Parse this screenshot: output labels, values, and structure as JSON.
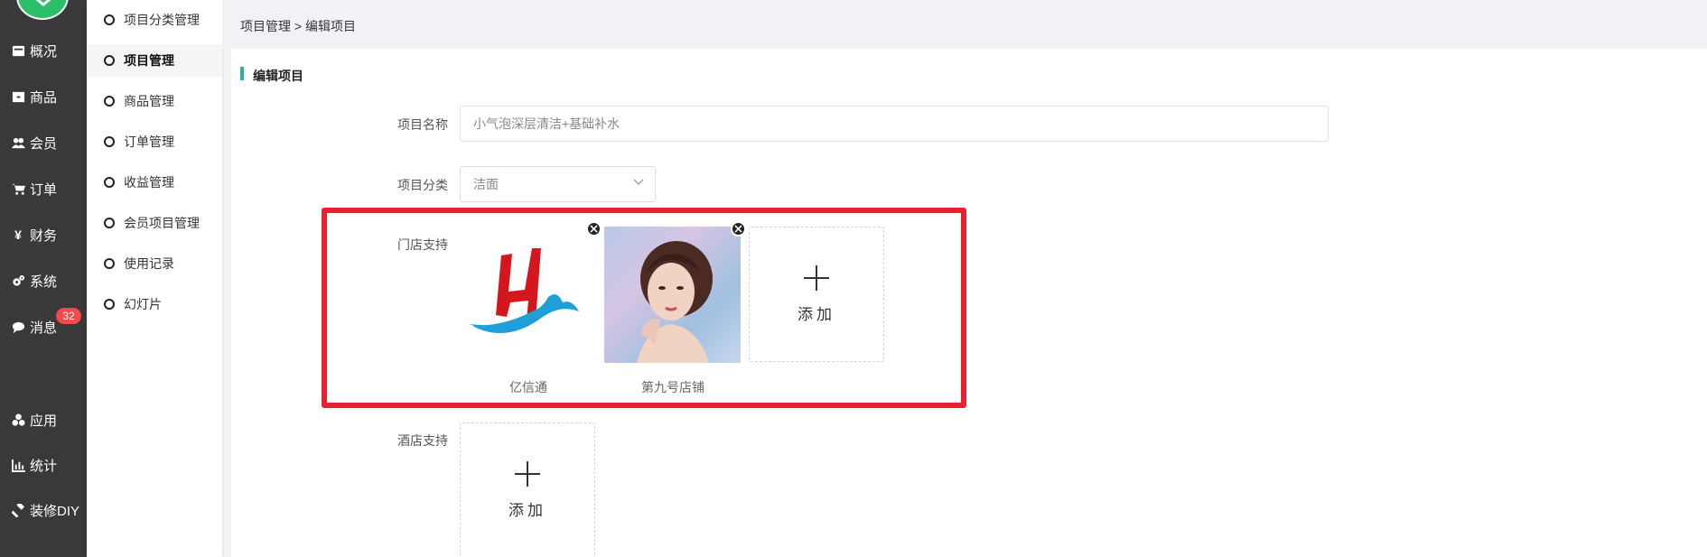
{
  "sidebar": {
    "items": [
      {
        "label": "概况",
        "icon": "overview-icon"
      },
      {
        "label": "商品",
        "icon": "goods-icon"
      },
      {
        "label": "会员",
        "icon": "members-icon"
      },
      {
        "label": "订单",
        "icon": "cart-icon"
      },
      {
        "label": "财务",
        "icon": "yen-icon"
      },
      {
        "label": "系统",
        "icon": "gears-icon"
      },
      {
        "label": "消息",
        "icon": "chat-icon",
        "badge": "32"
      },
      {
        "label": "应用",
        "icon": "apps-icon"
      },
      {
        "label": "统计",
        "icon": "chart-icon"
      },
      {
        "label": "装修DIY",
        "icon": "gavel-icon"
      }
    ]
  },
  "submenu": {
    "items": [
      {
        "label": "项目分类管理"
      },
      {
        "label": "项目管理"
      },
      {
        "label": "商品管理"
      },
      {
        "label": "订单管理"
      },
      {
        "label": "收益管理"
      },
      {
        "label": "会员项目管理"
      },
      {
        "label": "使用记录"
      },
      {
        "label": "幻灯片"
      }
    ],
    "active": "项目管理"
  },
  "breadcrumb": "项目管理 > 编辑项目",
  "section_title": "编辑项目",
  "form": {
    "name_label": "项目名称",
    "name_value": "小气泡深层清洁+基础补水",
    "category_label": "项目分类",
    "category_value": "洁面",
    "store_label": "门店支持",
    "stores": [
      {
        "caption": "亿信通"
      },
      {
        "caption": "第九号店铺"
      }
    ],
    "add_label": "添加",
    "hotel_label": "酒店支持"
  },
  "colors": {
    "sidebar_bg": "#393939",
    "accent": "#26b59a",
    "highlight_frame": "#e8202f",
    "badge": "#f04a4a"
  }
}
